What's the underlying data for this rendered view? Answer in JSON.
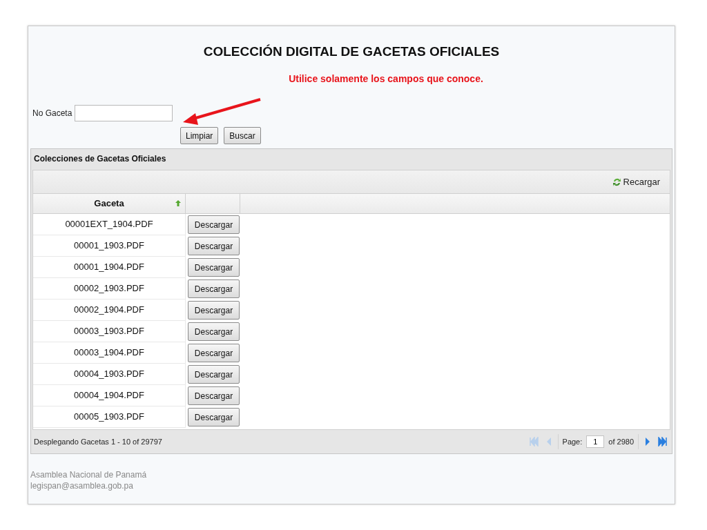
{
  "title": "COLECCIÓN DIGITAL DE GACETAS OFICIALES",
  "notice": "Utilice solamente los campos que conoce.",
  "search": {
    "label": "No Gaceta"
  },
  "buttons": [
    "Limpiar",
    "Buscar"
  ],
  "panel": {
    "title": "Colecciones de Gacetas Oficiales",
    "reload": "Recargar",
    "columns": [
      {
        "label": "Gaceta",
        "sorted": true
      }
    ],
    "rows": [
      {
        "file": "00001EXT_1904.PDF",
        "action": "Descargar"
      },
      {
        "file": "00001_1903.PDF",
        "action": "Descargar"
      },
      {
        "file": "00001_1904.PDF",
        "action": "Descargar"
      },
      {
        "file": "00002_1903.PDF",
        "action": "Descargar"
      },
      {
        "file": "00002_1904.PDF",
        "action": "Descargar"
      },
      {
        "file": "00003_1903.PDF",
        "action": "Descargar"
      },
      {
        "file": "00003_1904.PDF",
        "action": "Descargar"
      },
      {
        "file": "00004_1903.PDF",
        "action": "Descargar"
      },
      {
        "file": "00004_1904.PDF",
        "action": "Descargar"
      },
      {
        "file": "00005_1903.PDF",
        "action": "Descargar"
      }
    ],
    "status": "Desplegando Gacetas 1 - 10 of 29797",
    "pager": {
      "first_disabled": true,
      "prev_disabled": true,
      "page_label": "Page:",
      "page": "1",
      "of": "of 2980",
      "next_disabled": false,
      "last_disabled": false
    }
  },
  "footer": [
    "Asamblea Nacional de Panamá",
    "legispan@asamblea.gob.pa"
  ]
}
